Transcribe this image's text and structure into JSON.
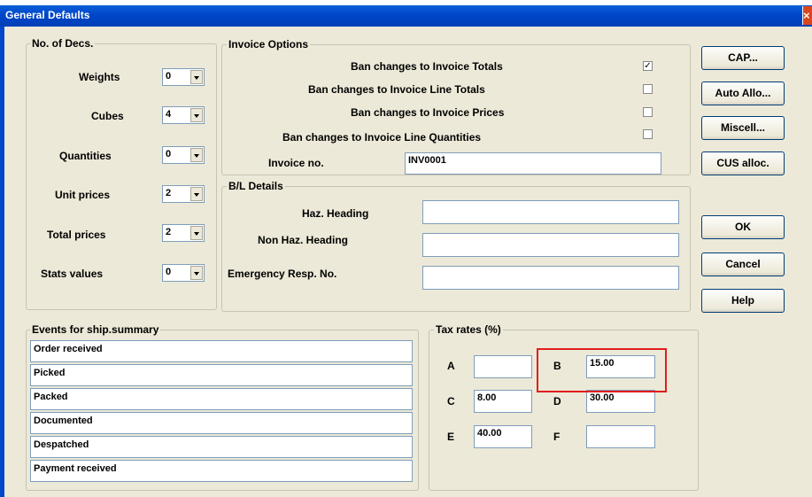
{
  "window": {
    "title": "General Defaults",
    "close_glyph": "×"
  },
  "decimals": {
    "legend": "No. of Decs.",
    "rows": [
      {
        "label": "Weights",
        "value": "0"
      },
      {
        "label": "Cubes",
        "value": "4"
      },
      {
        "label": "Quantities",
        "value": "0"
      },
      {
        "label": "Unit prices",
        "value": "2"
      },
      {
        "label": "Total prices",
        "value": "2"
      },
      {
        "label": "Stats values",
        "value": "0"
      }
    ]
  },
  "invoice_options": {
    "legend": "Invoice Options",
    "options": [
      {
        "label": "Ban changes to Invoice Totals",
        "checked": true
      },
      {
        "label": "Ban changes to Invoice Line Totals",
        "checked": false
      },
      {
        "label": "Ban changes to Invoice Prices",
        "checked": false
      },
      {
        "label": "Ban changes to Invoice Line Quantities",
        "checked": false
      }
    ],
    "invoice_no_label": "Invoice no.",
    "invoice_no_value": "INV0001",
    "check_glyph": "✓"
  },
  "bl_details": {
    "legend": "B/L Details",
    "haz_label": "Haz. Heading",
    "haz_value": "",
    "nonhaz_label": "Non Haz. Heading",
    "nonhaz_value": "",
    "emergency_label": "Emergency Resp. No.",
    "emergency_value": ""
  },
  "buttons": {
    "cap": "CAP...",
    "auto_allo": "Auto Allo...",
    "miscell": "Miscell...",
    "cus_alloc": "CUS alloc.",
    "ok": "OK",
    "cancel": "Cancel",
    "help": "Help"
  },
  "events": {
    "legend": "Events for ship.summary",
    "items": [
      "Order received",
      "Picked",
      "Packed",
      "Documented",
      "Despatched",
      "Payment received"
    ]
  },
  "tax_rates": {
    "legend": "Tax rates (%)",
    "rates": [
      {
        "label": "A",
        "value": ""
      },
      {
        "label": "B",
        "value": "15.00"
      },
      {
        "label": "C",
        "value": "8.00"
      },
      {
        "label": "D",
        "value": "30.00"
      },
      {
        "label": "E",
        "value": "40.00"
      },
      {
        "label": "F",
        "value": ""
      }
    ]
  },
  "colors": {
    "title_bar": "#0046c8",
    "dialog_bg": "#ece9d8",
    "highlight": "#e11d1d"
  }
}
